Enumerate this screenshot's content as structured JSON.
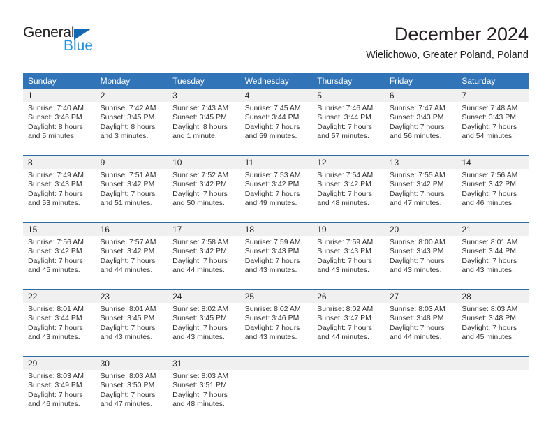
{
  "brand": {
    "name_part1": "General",
    "name_part2": "Blue",
    "triangle_color": "#1268b3",
    "blue_color": "#1f8fdd"
  },
  "header": {
    "title": "December 2024",
    "subtitle": "Wielichowo, Greater Poland, Poland"
  },
  "theme": {
    "header_bg": "#3174b8",
    "row_divider": "#2e6da4",
    "daynum_bg": "#f0f0f0",
    "text": "#231f20"
  },
  "calendar": {
    "weekday_headers": [
      "Sunday",
      "Monday",
      "Tuesday",
      "Wednesday",
      "Thursday",
      "Friday",
      "Saturday"
    ],
    "labels": {
      "sunrise": "Sunrise:",
      "sunset": "Sunset:",
      "daylight": "Daylight:"
    },
    "weeks": [
      [
        {
          "day": "1",
          "sunrise": "Sunrise: 7:40 AM",
          "sunset": "Sunset: 3:46 PM",
          "daylight_line1": "Daylight: 8 hours",
          "daylight_line2": "and 5 minutes."
        },
        {
          "day": "2",
          "sunrise": "Sunrise: 7:42 AM",
          "sunset": "Sunset: 3:45 PM",
          "daylight_line1": "Daylight: 8 hours",
          "daylight_line2": "and 3 minutes."
        },
        {
          "day": "3",
          "sunrise": "Sunrise: 7:43 AM",
          "sunset": "Sunset: 3:45 PM",
          "daylight_line1": "Daylight: 8 hours",
          "daylight_line2": "and 1 minute."
        },
        {
          "day": "4",
          "sunrise": "Sunrise: 7:45 AM",
          "sunset": "Sunset: 3:44 PM",
          "daylight_line1": "Daylight: 7 hours",
          "daylight_line2": "and 59 minutes."
        },
        {
          "day": "5",
          "sunrise": "Sunrise: 7:46 AM",
          "sunset": "Sunset: 3:44 PM",
          "daylight_line1": "Daylight: 7 hours",
          "daylight_line2": "and 57 minutes."
        },
        {
          "day": "6",
          "sunrise": "Sunrise: 7:47 AM",
          "sunset": "Sunset: 3:43 PM",
          "daylight_line1": "Daylight: 7 hours",
          "daylight_line2": "and 56 minutes."
        },
        {
          "day": "7",
          "sunrise": "Sunrise: 7:48 AM",
          "sunset": "Sunset: 3:43 PM",
          "daylight_line1": "Daylight: 7 hours",
          "daylight_line2": "and 54 minutes."
        }
      ],
      [
        {
          "day": "8",
          "sunrise": "Sunrise: 7:49 AM",
          "sunset": "Sunset: 3:43 PM",
          "daylight_line1": "Daylight: 7 hours",
          "daylight_line2": "and 53 minutes."
        },
        {
          "day": "9",
          "sunrise": "Sunrise: 7:51 AM",
          "sunset": "Sunset: 3:42 PM",
          "daylight_line1": "Daylight: 7 hours",
          "daylight_line2": "and 51 minutes."
        },
        {
          "day": "10",
          "sunrise": "Sunrise: 7:52 AM",
          "sunset": "Sunset: 3:42 PM",
          "daylight_line1": "Daylight: 7 hours",
          "daylight_line2": "and 50 minutes."
        },
        {
          "day": "11",
          "sunrise": "Sunrise: 7:53 AM",
          "sunset": "Sunset: 3:42 PM",
          "daylight_line1": "Daylight: 7 hours",
          "daylight_line2": "and 49 minutes."
        },
        {
          "day": "12",
          "sunrise": "Sunrise: 7:54 AM",
          "sunset": "Sunset: 3:42 PM",
          "daylight_line1": "Daylight: 7 hours",
          "daylight_line2": "and 48 minutes."
        },
        {
          "day": "13",
          "sunrise": "Sunrise: 7:55 AM",
          "sunset": "Sunset: 3:42 PM",
          "daylight_line1": "Daylight: 7 hours",
          "daylight_line2": "and 47 minutes."
        },
        {
          "day": "14",
          "sunrise": "Sunrise: 7:56 AM",
          "sunset": "Sunset: 3:42 PM",
          "daylight_line1": "Daylight: 7 hours",
          "daylight_line2": "and 46 minutes."
        }
      ],
      [
        {
          "day": "15",
          "sunrise": "Sunrise: 7:56 AM",
          "sunset": "Sunset: 3:42 PM",
          "daylight_line1": "Daylight: 7 hours",
          "daylight_line2": "and 45 minutes."
        },
        {
          "day": "16",
          "sunrise": "Sunrise: 7:57 AM",
          "sunset": "Sunset: 3:42 PM",
          "daylight_line1": "Daylight: 7 hours",
          "daylight_line2": "and 44 minutes."
        },
        {
          "day": "17",
          "sunrise": "Sunrise: 7:58 AM",
          "sunset": "Sunset: 3:42 PM",
          "daylight_line1": "Daylight: 7 hours",
          "daylight_line2": "and 44 minutes."
        },
        {
          "day": "18",
          "sunrise": "Sunrise: 7:59 AM",
          "sunset": "Sunset: 3:43 PM",
          "daylight_line1": "Daylight: 7 hours",
          "daylight_line2": "and 43 minutes."
        },
        {
          "day": "19",
          "sunrise": "Sunrise: 7:59 AM",
          "sunset": "Sunset: 3:43 PM",
          "daylight_line1": "Daylight: 7 hours",
          "daylight_line2": "and 43 minutes."
        },
        {
          "day": "20",
          "sunrise": "Sunrise: 8:00 AM",
          "sunset": "Sunset: 3:43 PM",
          "daylight_line1": "Daylight: 7 hours",
          "daylight_line2": "and 43 minutes."
        },
        {
          "day": "21",
          "sunrise": "Sunrise: 8:01 AM",
          "sunset": "Sunset: 3:44 PM",
          "daylight_line1": "Daylight: 7 hours",
          "daylight_line2": "and 43 minutes."
        }
      ],
      [
        {
          "day": "22",
          "sunrise": "Sunrise: 8:01 AM",
          "sunset": "Sunset: 3:44 PM",
          "daylight_line1": "Daylight: 7 hours",
          "daylight_line2": "and 43 minutes."
        },
        {
          "day": "23",
          "sunrise": "Sunrise: 8:01 AM",
          "sunset": "Sunset: 3:45 PM",
          "daylight_line1": "Daylight: 7 hours",
          "daylight_line2": "and 43 minutes."
        },
        {
          "day": "24",
          "sunrise": "Sunrise: 8:02 AM",
          "sunset": "Sunset: 3:45 PM",
          "daylight_line1": "Daylight: 7 hours",
          "daylight_line2": "and 43 minutes."
        },
        {
          "day": "25",
          "sunrise": "Sunrise: 8:02 AM",
          "sunset": "Sunset: 3:46 PM",
          "daylight_line1": "Daylight: 7 hours",
          "daylight_line2": "and 43 minutes."
        },
        {
          "day": "26",
          "sunrise": "Sunrise: 8:02 AM",
          "sunset": "Sunset: 3:47 PM",
          "daylight_line1": "Daylight: 7 hours",
          "daylight_line2": "and 44 minutes."
        },
        {
          "day": "27",
          "sunrise": "Sunrise: 8:03 AM",
          "sunset": "Sunset: 3:48 PM",
          "daylight_line1": "Daylight: 7 hours",
          "daylight_line2": "and 44 minutes."
        },
        {
          "day": "28",
          "sunrise": "Sunrise: 8:03 AM",
          "sunset": "Sunset: 3:48 PM",
          "daylight_line1": "Daylight: 7 hours",
          "daylight_line2": "and 45 minutes."
        }
      ],
      [
        {
          "day": "29",
          "sunrise": "Sunrise: 8:03 AM",
          "sunset": "Sunset: 3:49 PM",
          "daylight_line1": "Daylight: 7 hours",
          "daylight_line2": "and 46 minutes."
        },
        {
          "day": "30",
          "sunrise": "Sunrise: 8:03 AM",
          "sunset": "Sunset: 3:50 PM",
          "daylight_line1": "Daylight: 7 hours",
          "daylight_line2": "and 47 minutes."
        },
        {
          "day": "31",
          "sunrise": "Sunrise: 8:03 AM",
          "sunset": "Sunset: 3:51 PM",
          "daylight_line1": "Daylight: 7 hours",
          "daylight_line2": "and 48 minutes."
        },
        {
          "day": "",
          "sunrise": "",
          "sunset": "",
          "daylight_line1": "",
          "daylight_line2": ""
        },
        {
          "day": "",
          "sunrise": "",
          "sunset": "",
          "daylight_line1": "",
          "daylight_line2": ""
        },
        {
          "day": "",
          "sunrise": "",
          "sunset": "",
          "daylight_line1": "",
          "daylight_line2": ""
        },
        {
          "day": "",
          "sunrise": "",
          "sunset": "",
          "daylight_line1": "",
          "daylight_line2": ""
        }
      ]
    ]
  }
}
